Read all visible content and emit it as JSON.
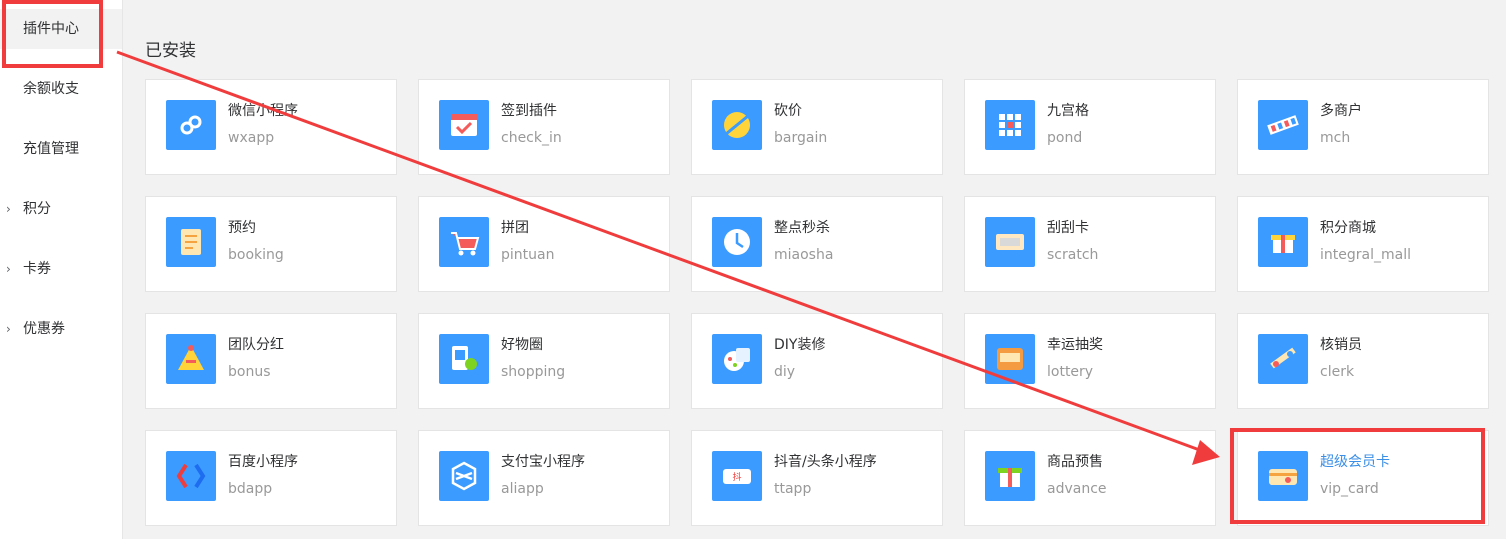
{
  "sidebar": {
    "items": [
      {
        "label": "插件中心",
        "expandable": false,
        "active": true
      },
      {
        "label": "余额收支",
        "expandable": false,
        "active": false
      },
      {
        "label": "充值管理",
        "expandable": false,
        "active": false
      },
      {
        "label": "积分",
        "expandable": true,
        "active": false
      },
      {
        "label": "卡券",
        "expandable": true,
        "active": false
      },
      {
        "label": "优惠券",
        "expandable": true,
        "active": false
      }
    ],
    "chevron": "›"
  },
  "main": {
    "section_title": "已安装",
    "plugins": [
      {
        "cn": "微信小程序",
        "en": "wxapp",
        "icon": "mini-program-icon"
      },
      {
        "cn": "签到插件",
        "en": "check_in",
        "icon": "calendar-checkin-icon"
      },
      {
        "cn": "砍价",
        "en": "bargain",
        "icon": "bargain-tag-icon"
      },
      {
        "cn": "九宫格",
        "en": "pond",
        "icon": "grid-nine-icon"
      },
      {
        "cn": "多商户",
        "en": "mch",
        "icon": "multi-store-icon"
      },
      {
        "cn": "预约",
        "en": "booking",
        "icon": "booking-note-icon"
      },
      {
        "cn": "拼团",
        "en": "pintuan",
        "icon": "shopping-cart-icon"
      },
      {
        "cn": "整点秒杀",
        "en": "miaosha",
        "icon": "flash-clock-icon"
      },
      {
        "cn": "刮刮卡",
        "en": "scratch",
        "icon": "scratch-card-icon"
      },
      {
        "cn": "积分商城",
        "en": "integral_mall",
        "icon": "points-gift-icon"
      },
      {
        "cn": "团队分红",
        "en": "bonus",
        "icon": "team-pyramid-icon"
      },
      {
        "cn": "好物圈",
        "en": "shopping",
        "icon": "good-items-icon"
      },
      {
        "cn": "DIY装修",
        "en": "diy",
        "icon": "diy-design-icon"
      },
      {
        "cn": "幸运抽奖",
        "en": "lottery",
        "icon": "lottery-box-icon"
      },
      {
        "cn": "核销员",
        "en": "clerk",
        "icon": "clerk-verify-icon"
      },
      {
        "cn": "百度小程序",
        "en": "bdapp",
        "icon": "baidu-icon"
      },
      {
        "cn": "支付宝小程序",
        "en": "aliapp",
        "icon": "alipay-icon"
      },
      {
        "cn": "抖音/头条小程序",
        "en": "ttapp",
        "icon": "douyin-icon"
      },
      {
        "cn": "商品预售",
        "en": "advance",
        "icon": "presale-gift-icon"
      },
      {
        "cn": "超级会员卡",
        "en": "vip_card",
        "icon": "vip-card-icon",
        "active": true
      }
    ]
  },
  "colors": {
    "icon_bg": "#3b9bff",
    "highlight": "#f03c3c",
    "active_link": "#3b8fe6"
  }
}
